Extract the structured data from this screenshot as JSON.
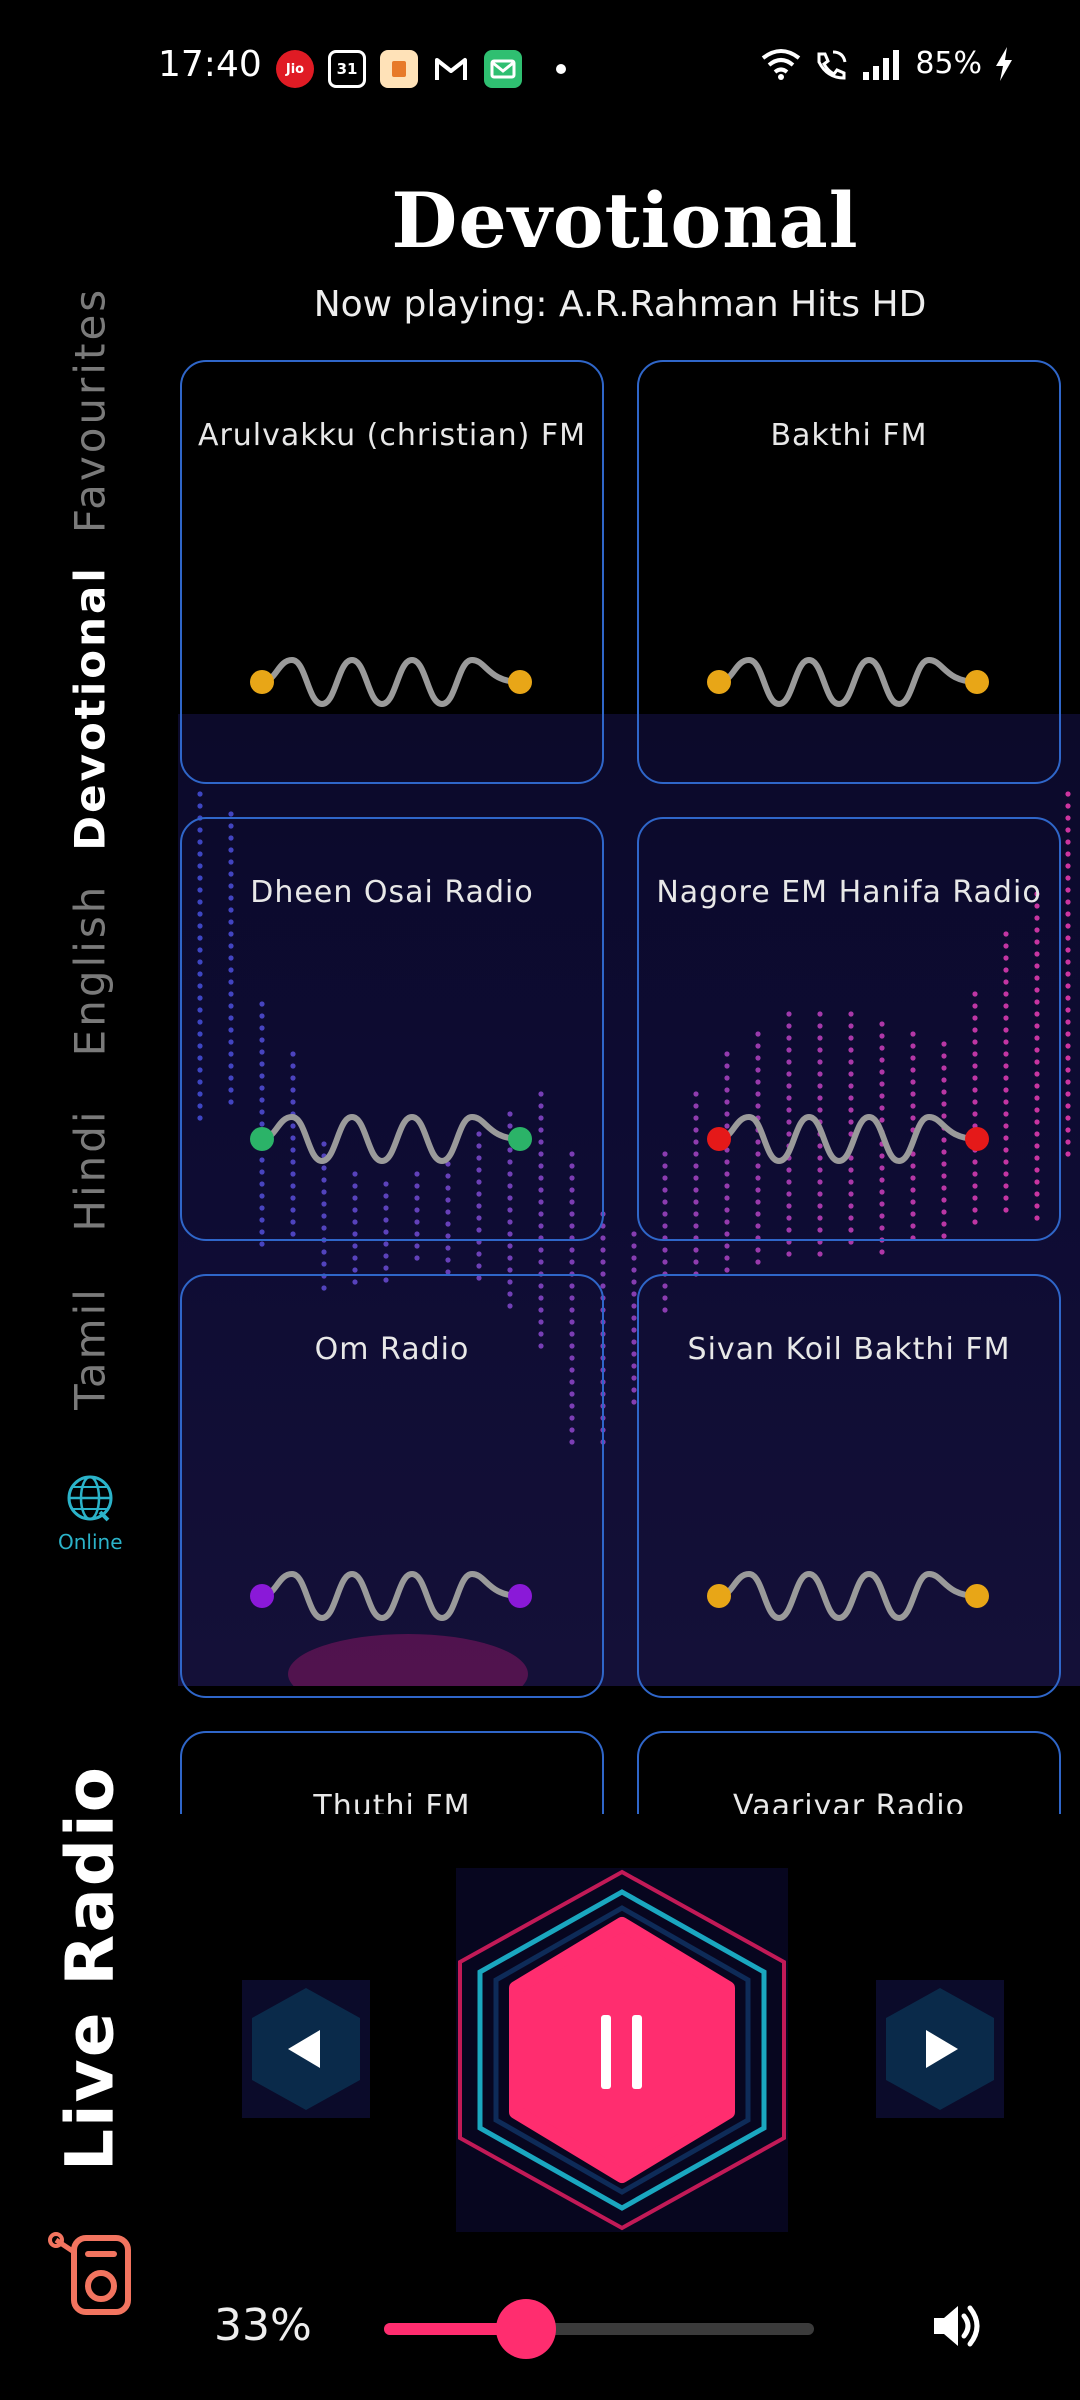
{
  "status_bar": {
    "time": "17:40",
    "notification_icons": [
      "jio-icon",
      "calendar-icon",
      "app-icon",
      "gmail-icon",
      "mail-icon"
    ],
    "calendar_day": "31",
    "jio_label": "Jio",
    "battery": "85%"
  },
  "header": {
    "category_title": "Devotional",
    "now_playing": "Now playing: A.R.Rahman Hits HD"
  },
  "sidebar": {
    "tabs": [
      {
        "label": "Favourites",
        "active": false
      },
      {
        "label": "Devotional",
        "active": true
      },
      {
        "label": "English",
        "active": false
      },
      {
        "label": "Hindi",
        "active": false
      },
      {
        "label": "Tamil",
        "active": false
      }
    ],
    "online_label": "Online",
    "app_title": "Live Radio"
  },
  "stations": [
    {
      "name": "Arulvakku (christian) FM",
      "dot_color": "#e8a617"
    },
    {
      "name": "Bakthi FM",
      "dot_color": "#e8a617"
    },
    {
      "name": "Dheen Osai Radio",
      "dot_color": "#2bb368"
    },
    {
      "name": "Nagore EM Hanifa Radio",
      "dot_color": "#e51919"
    },
    {
      "name": "Om Radio",
      "dot_color": "#8a19d8"
    },
    {
      "name": "Sivan Koil Bakthi FM",
      "dot_color": "#e8a617"
    },
    {
      "name": "Thuthi FM",
      "dot_color": "#e8a617"
    },
    {
      "name": "Vaariyar Radio",
      "dot_color": "#e8a617"
    }
  ],
  "player": {
    "volume_label": "33%",
    "volume_level": 0.33,
    "accent": "#ff2d6f"
  }
}
